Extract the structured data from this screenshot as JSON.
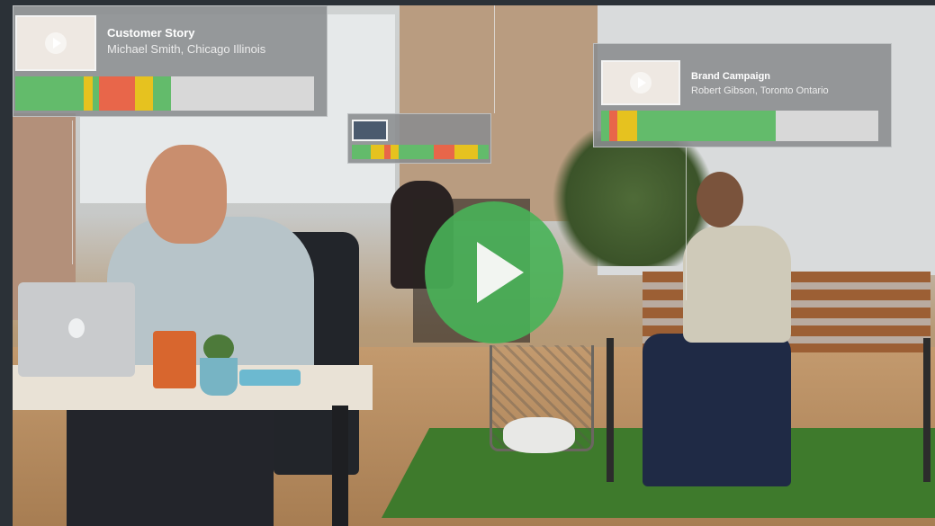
{
  "cards": [
    {
      "title": "Customer Story",
      "subtitle": "Michael Smith, Chicago Illinois",
      "segments": [
        {
          "color": "#63bb6b",
          "share": 0.23
        },
        {
          "color": "#e6c21f",
          "share": 0.03
        },
        {
          "color": "#63bb6b",
          "share": 0.02
        },
        {
          "color": "#e8664a",
          "share": 0.12
        },
        {
          "color": "#e6c21f",
          "share": 0.06
        },
        {
          "color": "#63bb6b",
          "share": 0.06
        },
        {
          "color": "#d8d8d8",
          "share": 0.48
        }
      ]
    },
    {
      "title": "",
      "subtitle": "",
      "segments": [
        {
          "color": "#63bb6b",
          "share": 0.14
        },
        {
          "color": "#e6c21f",
          "share": 0.1
        },
        {
          "color": "#e8664a",
          "share": 0.04
        },
        {
          "color": "#e6c21f",
          "share": 0.06
        },
        {
          "color": "#63bb6b",
          "share": 0.26
        },
        {
          "color": "#e8664a",
          "share": 0.15
        },
        {
          "color": "#e6c21f",
          "share": 0.17
        },
        {
          "color": "#63bb6b",
          "share": 0.08
        }
      ]
    },
    {
      "title": "Brand Campaign",
      "subtitle": "Robert Gibson, Toronto Ontario",
      "segments": [
        {
          "color": "#63bb6b",
          "share": 0.03
        },
        {
          "color": "#e8664a",
          "share": 0.03
        },
        {
          "color": "#e6c21f",
          "share": 0.07
        },
        {
          "color": "#63bb6b",
          "share": 0.5
        },
        {
          "color": "#d8d8d8",
          "share": 0.37
        }
      ]
    }
  ],
  "icons": {
    "main_play": "play-icon",
    "thumb_play": "play-icon"
  },
  "colors": {
    "play_button": "#48b258",
    "green": "#63bb6b",
    "yellow": "#e6c21f",
    "red": "#e8664a",
    "empty": "#d8d8d8"
  }
}
